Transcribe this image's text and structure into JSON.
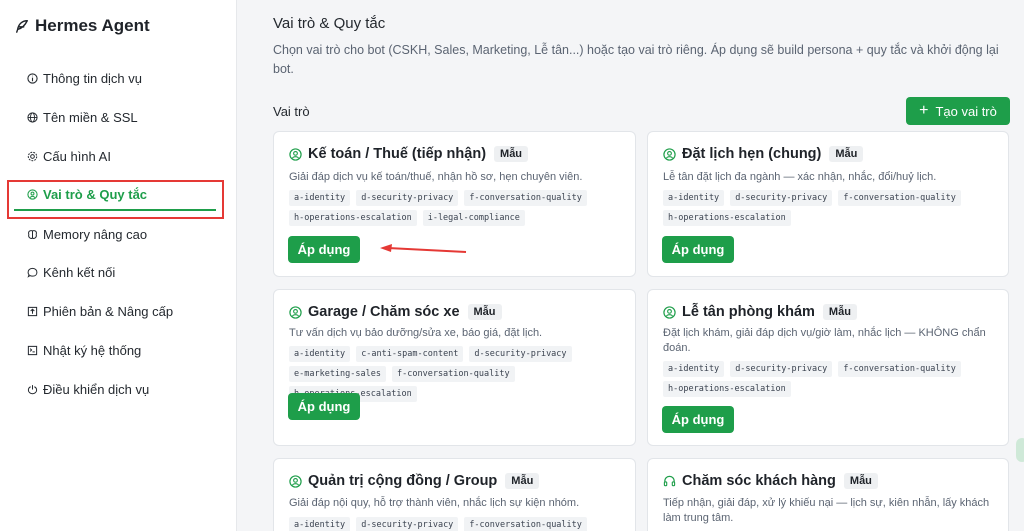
{
  "app": {
    "title": "Hermes Agent",
    "accent_color": "#1e9e4a",
    "highlight_color": "#e53935"
  },
  "sidebar": {
    "items": [
      {
        "label": "Thông tin dịch vụ",
        "icon": "info-icon"
      },
      {
        "label": "Tên miền & SSL",
        "icon": "globe-icon"
      },
      {
        "label": "Cấu hình AI",
        "icon": "gear-icon"
      },
      {
        "label": "Vai trò & Quy tắc",
        "icon": "user-badge-icon",
        "active": true
      },
      {
        "label": "Memory nâng cao",
        "icon": "brain-icon"
      },
      {
        "label": "Kênh kết nối",
        "icon": "chat-bubble-icon"
      },
      {
        "label": "Phiên bản & Nâng cấp",
        "icon": "upgrade-icon"
      },
      {
        "label": "Nhật ký hệ thống",
        "icon": "log-icon"
      },
      {
        "label": "Điều khiển dịch vụ",
        "icon": "power-icon"
      }
    ]
  },
  "main": {
    "title": "Vai trò & Quy tắc",
    "description": "Chọn vai trò cho bot (CSKH, Sales, Marketing, Lễ tân...) hoặc tạo vai trò riêng. Áp dụng sẽ build persona + quy tắc và khởi động lại bot.",
    "section_label": "Vai trò",
    "add_button": "Tạo vai trò",
    "apply_label": "Áp dụng",
    "badge_label": "Mẫu",
    "cards": [
      {
        "title": "Kế toán / Thuế (tiếp nhận)",
        "desc": "Giải đáp dịch vụ kế toán/thuế, nhận hồ sơ, hẹn chuyên viên.",
        "icon": "user-circle-icon",
        "tags": [
          "a-identity",
          "d-security-privacy",
          "f-conversation-quality",
          "h-operations-escalation",
          "i-legal-compliance"
        ]
      },
      {
        "title": "Đặt lịch hẹn (chung)",
        "desc": "Lễ tân đặt lịch đa ngành — xác nhận, nhắc, đổi/huỷ lịch.",
        "icon": "user-circle-icon",
        "tags": [
          "a-identity",
          "d-security-privacy",
          "f-conversation-quality",
          "h-operations-escalation"
        ]
      },
      {
        "title": "Garage / Chăm sóc xe",
        "desc": "Tư vấn dịch vụ bảo dưỡng/sửa xe, báo giá, đặt lịch.",
        "icon": "user-circle-icon",
        "tags": [
          "a-identity",
          "c-anti-spam-content",
          "d-security-privacy",
          "e-marketing-sales",
          "f-conversation-quality",
          "h-operations-escalation"
        ]
      },
      {
        "title": "Lễ tân phòng khám",
        "desc": "Đặt lịch khám, giải đáp dịch vụ/giờ làm, nhắc lịch — KHÔNG chẩn đoán.",
        "icon": "user-circle-icon",
        "tags": [
          "a-identity",
          "d-security-privacy",
          "f-conversation-quality",
          "h-operations-escalation"
        ]
      },
      {
        "title": "Quản trị cộng đồng / Group",
        "desc": "Giải đáp nội quy, hỗ trợ thành viên, nhắc lịch sự kiện nhóm.",
        "icon": "user-circle-icon",
        "tags": [
          "a-identity",
          "d-security-privacy",
          "f-conversation-quality"
        ]
      },
      {
        "title": "Chăm sóc khách hàng",
        "desc": "Tiếp nhận, giải đáp, xử lý khiếu nại — lịch sự, kiên nhẫn, lấy khách làm trung tâm.",
        "icon": "headset-icon",
        "tags": []
      }
    ]
  }
}
